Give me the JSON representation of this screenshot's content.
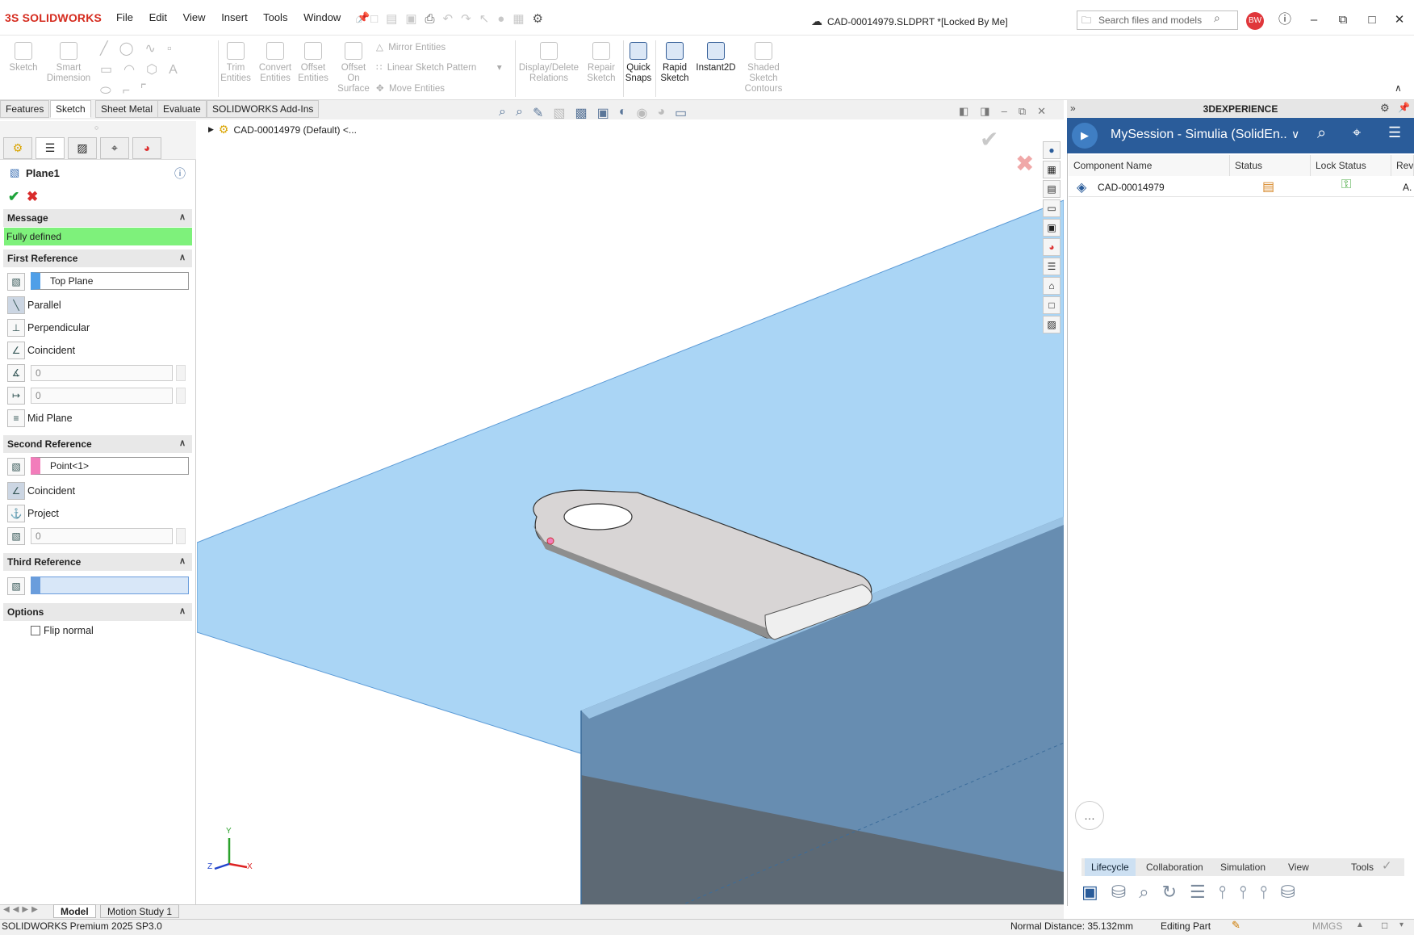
{
  "app": {
    "brand_prefix": "3S",
    "brand": "SOLIDWORKS",
    "document_title": "CAD-00014979.SLDPRT *[Locked By Me]"
  },
  "menu": [
    "File",
    "Edit",
    "View",
    "Insert",
    "Tools",
    "Window"
  ],
  "search": {
    "placeholder": "Search files and models"
  },
  "user": {
    "initials": "BW"
  },
  "ribbon": {
    "sketch": "Sketch",
    "smart_dimension": "Smart Dimension",
    "trim": "Trim Entities",
    "convert": "Convert Entities",
    "offset": "Offset Entities",
    "offset_surface": "Offset On Surface",
    "mirror": "Mirror Entities",
    "linear_pattern": "Linear Sketch Pattern",
    "move": "Move Entities",
    "display_relations": "Display/Delete Relations",
    "repair": "Repair Sketch",
    "quick_snaps": "Quick Snaps",
    "rapid_sketch": "Rapid Sketch",
    "instant2d": "Instant2D",
    "shaded_contours": "Shaded Sketch Contours"
  },
  "tabs": [
    "Features",
    "Sketch",
    "Sheet Metal",
    "Evaluate",
    "SOLIDWORKS Add-Ins"
  ],
  "tree": {
    "label": "CAD-00014979 (Default) <..."
  },
  "pm": {
    "title": "Plane1",
    "message_header": "Message",
    "message": "Fully defined",
    "first_ref_header": "First Reference",
    "first_ref_value": "Top Plane",
    "opt_parallel": "Parallel",
    "opt_perpendicular": "Perpendicular",
    "opt_coincident": "Coincident",
    "offset_value": "0",
    "angle_value": "0",
    "opt_mid": "Mid Plane",
    "second_ref_header": "Second Reference",
    "second_ref_value": "Point<1>",
    "opt_coincident2": "Coincident",
    "opt_project": "Project",
    "project_value": "0",
    "third_ref_header": "Third Reference",
    "third_ref_value": "",
    "options_header": "Options",
    "flip_normal": "Flip normal",
    "colors": {
      "first": "#4f9fe8",
      "second": "#f27dbb",
      "third": "#7b21d8",
      "ok": "#1ea33a",
      "cancel": "#d92b2b",
      "message_bg": "#7ef17b"
    }
  },
  "right": {
    "panel_title": "3DEXPERIENCE",
    "session": "MySession - Simulia (SolidEn...",
    "columns": [
      "Component Name",
      "Status",
      "Lock Status",
      "Rev"
    ],
    "rows": [
      {
        "name": "CAD-00014979",
        "rev": "A."
      }
    ],
    "tabs": [
      "Lifecycle",
      "Collaboration",
      "Simulation",
      "View",
      "Tools"
    ]
  },
  "bottom_tabs": [
    "Model",
    "Motion Study 1"
  ],
  "status": {
    "product": "SOLIDWORKS Premium 2025 SP3.0",
    "distance": "Normal Distance: 35.132mm",
    "mode": "Editing Part",
    "units": "MMGS"
  },
  "triad": {
    "x": "X",
    "y": "Y",
    "z": "Z"
  }
}
